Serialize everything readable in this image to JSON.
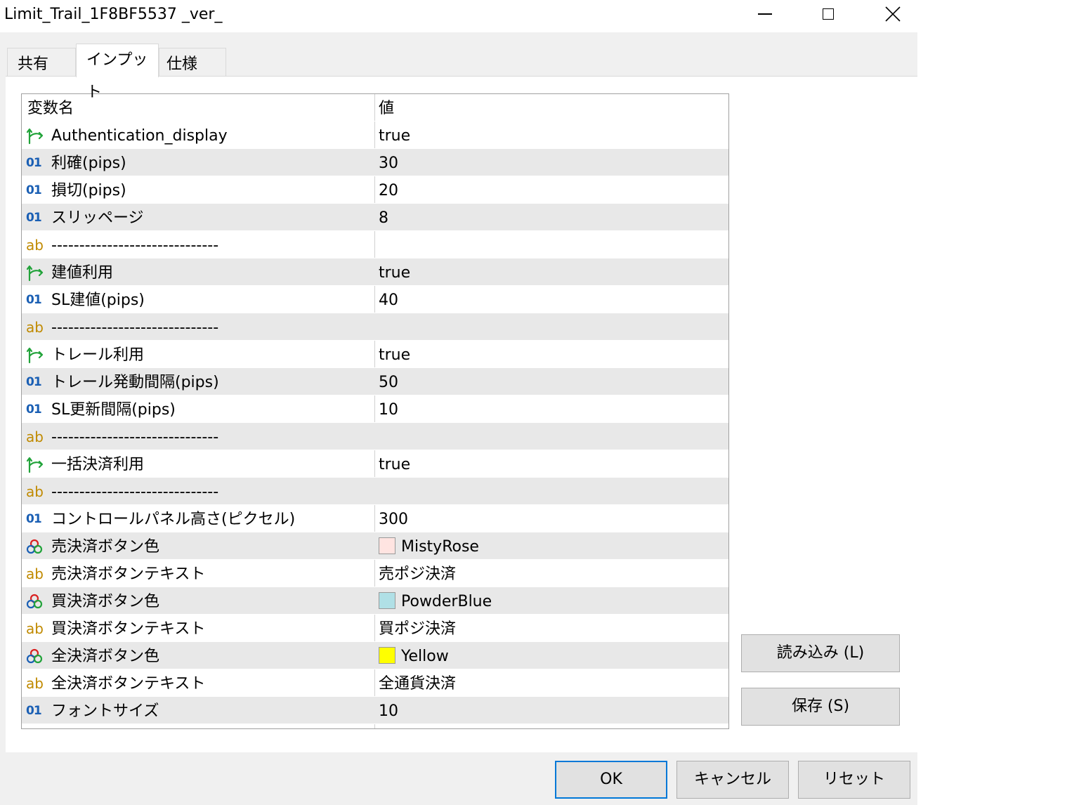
{
  "window": {
    "title": "Limit_Trail_1F8BF5537 _ver_"
  },
  "tabs": [
    {
      "label": "共有"
    },
    {
      "label": "インプット",
      "active": true
    },
    {
      "label": "仕様"
    }
  ],
  "grid": {
    "header": {
      "name": "変数名",
      "value": "値"
    },
    "rows": [
      {
        "icon": "bool-arrow-icon",
        "name": "Authentication_display",
        "value": "true"
      },
      {
        "icon": "int-01-icon",
        "name": "利確(pips)",
        "value": "30"
      },
      {
        "icon": "int-01-icon",
        "name": "損切(pips)",
        "value": "20"
      },
      {
        "icon": "int-01-icon",
        "name": "スリッページ",
        "value": "8"
      },
      {
        "icon": "string-ab-icon",
        "name": "------------------------------",
        "value": ""
      },
      {
        "icon": "bool-arrow-icon",
        "name": "建値利用",
        "value": "true"
      },
      {
        "icon": "int-01-icon",
        "name": "SL建値(pips)",
        "value": "40"
      },
      {
        "icon": "string-ab-icon",
        "name": "------------------------------",
        "value": ""
      },
      {
        "icon": "bool-arrow-icon",
        "name": "トレール利用",
        "value": "true"
      },
      {
        "icon": "int-01-icon",
        "name": "トレール発動間隔(pips)",
        "value": "50"
      },
      {
        "icon": "int-01-icon",
        "name": "SL更新間隔(pips)",
        "value": "10"
      },
      {
        "icon": "string-ab-icon",
        "name": "------------------------------",
        "value": ""
      },
      {
        "icon": "bool-arrow-icon",
        "name": "一括決済利用",
        "value": "true"
      },
      {
        "icon": "string-ab-icon",
        "name": "------------------------------",
        "value": ""
      },
      {
        "icon": "int-01-icon",
        "name": "コントロールパネル高さ(ピクセル)",
        "value": "300"
      },
      {
        "icon": "color-circles-icon",
        "name": "売決済ボタン色",
        "value": "MistyRose",
        "swatch": "#ffe4e1"
      },
      {
        "icon": "string-ab-icon",
        "name": "売決済ボタンテキスト",
        "value": "売ポジ決済"
      },
      {
        "icon": "color-circles-icon",
        "name": "買決済ボタン色",
        "value": "PowderBlue",
        "swatch": "#b0e0e6"
      },
      {
        "icon": "string-ab-icon",
        "name": "買決済ボタンテキスト",
        "value": "買ポジ決済"
      },
      {
        "icon": "color-circles-icon",
        "name": "全決済ボタン色",
        "value": "Yellow",
        "swatch": "#ffff00"
      },
      {
        "icon": "string-ab-icon",
        "name": "全決済ボタンテキスト",
        "value": "全通貨決済"
      },
      {
        "icon": "int-01-icon",
        "name": "フォントサイズ",
        "value": "10"
      }
    ]
  },
  "side_buttons": {
    "load": "読み込み (L)",
    "save": "保存 (S)"
  },
  "bottom_buttons": {
    "ok": "OK",
    "cancel": "キャンセル",
    "reset": "リセット"
  },
  "icon_glyphs": {
    "int-01-icon": "01",
    "string-ab-icon": "ab"
  },
  "colors": {
    "alt_row": "#e8e8e8",
    "bool_icon": "#22a33a",
    "int_icon": "#1a5fb4",
    "string_icon": "#c08a00",
    "ok_border": "#0078d7"
  }
}
